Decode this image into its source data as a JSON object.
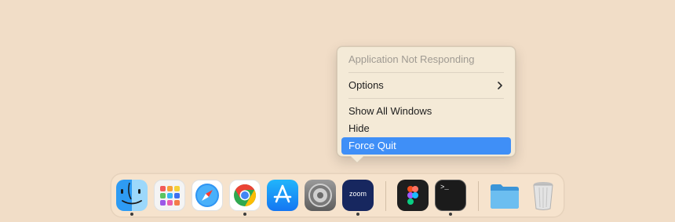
{
  "context_menu": {
    "title": "Application Not Responding",
    "items": [
      {
        "label": "Options",
        "submenu": true
      },
      {
        "label": "Show All Windows"
      },
      {
        "label": "Hide"
      },
      {
        "label": "Force Quit",
        "highlighted": true
      }
    ]
  },
  "dock": {
    "apps": [
      {
        "name": "Finder",
        "icon": "finder-icon",
        "running": true
      },
      {
        "name": "Launchpad",
        "icon": "launchpad-icon",
        "running": false
      },
      {
        "name": "Safari",
        "icon": "safari-icon",
        "running": false
      },
      {
        "name": "Google Chrome",
        "icon": "chrome-icon",
        "running": true
      },
      {
        "name": "App Store",
        "icon": "app-store-icon",
        "running": false
      },
      {
        "name": "System Settings",
        "icon": "gear-icon",
        "running": false
      },
      {
        "name": "Zoom",
        "icon": "zoom-icon",
        "label": "zoom",
        "running": true
      },
      {
        "name": "Figma",
        "icon": "figma-icon",
        "running": false
      },
      {
        "name": "Terminal",
        "icon": "terminal-icon",
        "label": ">_",
        "running": true
      },
      {
        "name": "Folder",
        "icon": "folder-icon",
        "running": false
      },
      {
        "name": "Trash",
        "icon": "trash-icon",
        "running": false
      }
    ]
  },
  "colors": {
    "desktop": "#f1ddc7",
    "menu_background": "#f4ead7",
    "highlight": "#3f8ff7"
  }
}
